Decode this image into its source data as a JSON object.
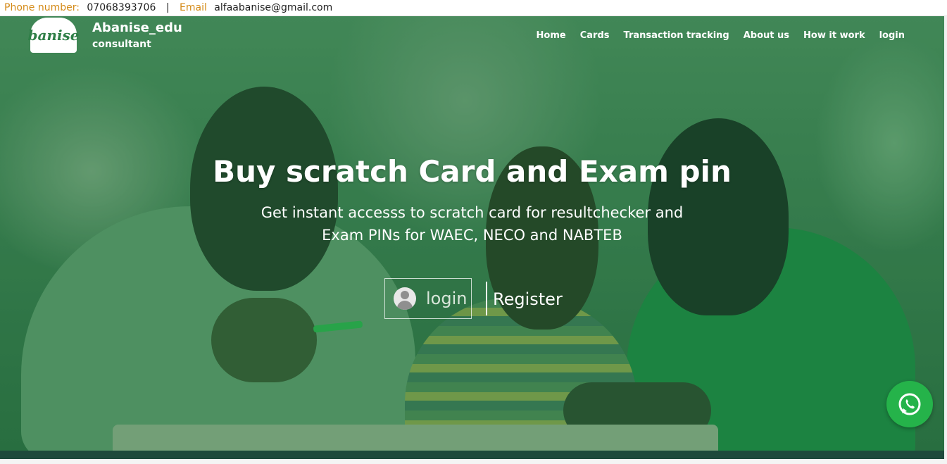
{
  "topbar": {
    "phone_label": "Phone number:",
    "phone_value": "07068393706",
    "separator": "|",
    "email_label": "Email",
    "email_value": "alfaabanise@gmail.com"
  },
  "brand": {
    "logo_text": "banise",
    "name": "Abanise_edu",
    "subtitle": "consultant"
  },
  "nav": {
    "items": [
      {
        "label": "Home"
      },
      {
        "label": "Cards"
      },
      {
        "label": "Transaction tracking"
      },
      {
        "label": "About us"
      },
      {
        "label": "How it work"
      },
      {
        "label": "login"
      }
    ]
  },
  "hero": {
    "title": "Buy scratch Card and Exam pin",
    "subtitle_line1": "Get instant accesss to scratch card for resultchecker and",
    "subtitle_line2": "Exam PINs for WAEC, NECO and NABTEB",
    "login_label": "login",
    "register_label": "Register"
  },
  "colors": {
    "accent_orange": "#d48a17",
    "hero_green": "#3f7f52",
    "whatsapp_green": "#25b34a"
  },
  "icons": {
    "login_avatar": "user-avatar-icon",
    "whatsapp": "whatsapp-icon"
  }
}
